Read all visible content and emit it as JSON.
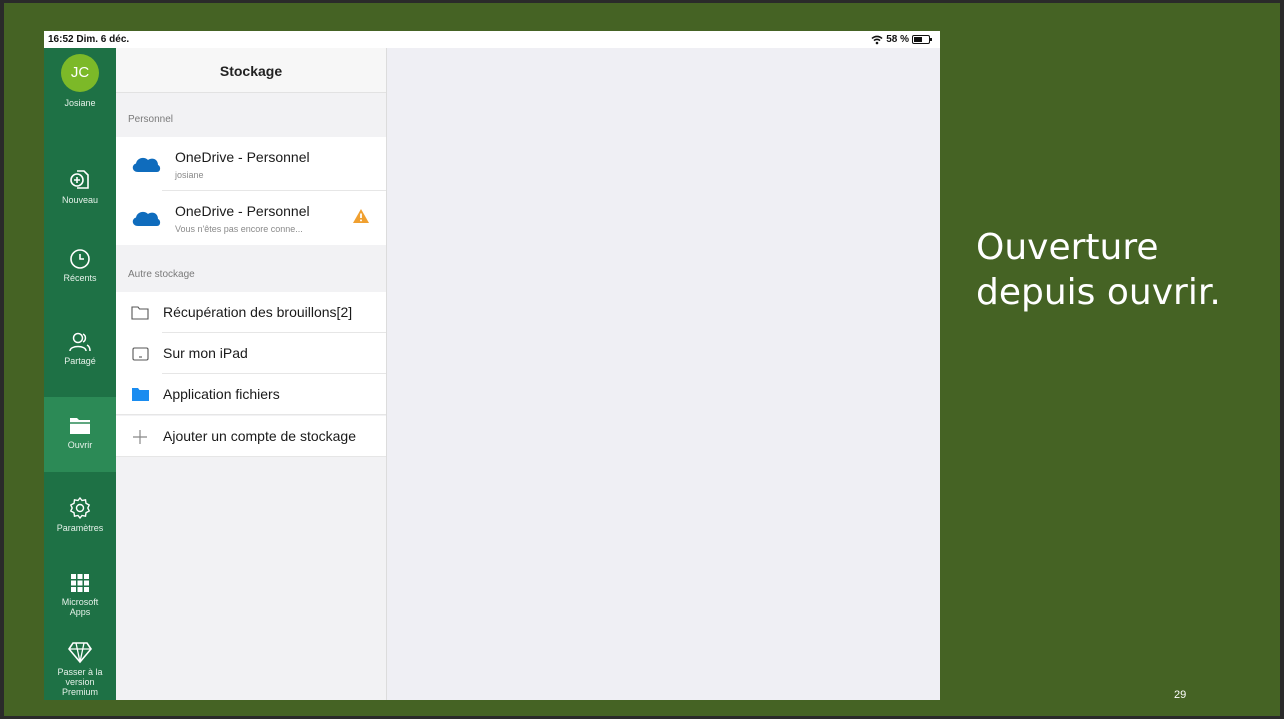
{
  "status_bar": {
    "time": "16:52",
    "date": "Dim. 6 déc.",
    "battery": "58 %"
  },
  "sidebar": {
    "account": {
      "initials": "JC",
      "name": "Josiane"
    },
    "items": [
      {
        "label": "Nouveau",
        "icon": "new-document-icon"
      },
      {
        "label": "Récents",
        "icon": "clock-icon"
      },
      {
        "label": "Partagé",
        "icon": "shared-people-icon"
      },
      {
        "label": "Ouvrir",
        "icon": "folder-open-icon",
        "active": true
      },
      {
        "label": "Paramètres",
        "icon": "gear-icon"
      },
      {
        "label": "Microsoft Apps",
        "icon": "apps-grid-icon"
      },
      {
        "label": "Passer à la version Premium",
        "icon": "diamond-icon"
      }
    ]
  },
  "panel": {
    "title": "Stockage",
    "personal_section": "Personnel",
    "personal_items": [
      {
        "title": "OneDrive - Personnel",
        "subtitle": "josiane"
      },
      {
        "title": "OneDrive - Personnel",
        "subtitle": "Vous n'êtes pas encore conne...",
        "warning": true
      }
    ],
    "other_section": "Autre stockage",
    "other_items": [
      {
        "title": "Récupération des brouillons[2]",
        "icon": "folder-outline-icon"
      },
      {
        "title": "Sur mon iPad",
        "icon": "ipad-icon"
      },
      {
        "title": "Application fichiers",
        "icon": "files-folder-icon"
      },
      {
        "title": "Ajouter un compte de stockage",
        "icon": "plus-icon"
      }
    ]
  },
  "slide": {
    "caption": "Ouverture depuis ouvrir.",
    "page_number": "29"
  },
  "colors": {
    "slide_background": "#456324",
    "sidebar": "#1e7145",
    "avatar": "#7cb928",
    "onedrive_blue": "#0f6cbd",
    "warning": "#f0a030"
  }
}
